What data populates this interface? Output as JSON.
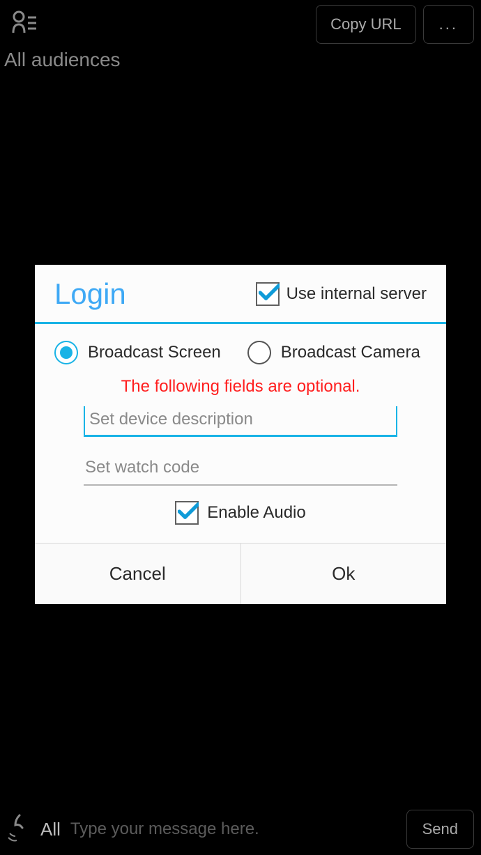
{
  "topbar": {
    "copy_url_label": "Copy URL",
    "more_label": "..."
  },
  "subheader": "All audiences",
  "dialog": {
    "title": "Login",
    "use_internal_server_label": "Use internal server",
    "use_internal_server_checked": true,
    "radio_screen_label": "Broadcast Screen",
    "radio_camera_label": "Broadcast Camera",
    "radio_selected": "screen",
    "optional_note": "The following fields are optional.",
    "device_desc_placeholder": "Set device description",
    "device_desc_value": "",
    "watch_code_placeholder": "Set watch code",
    "watch_code_value": "",
    "enable_audio_label": "Enable Audio",
    "enable_audio_checked": true,
    "cancel_label": "Cancel",
    "ok_label": "Ok"
  },
  "bottombar": {
    "audience_label": "All",
    "message_placeholder": "Type your message here.",
    "message_value": "",
    "send_label": "Send"
  }
}
